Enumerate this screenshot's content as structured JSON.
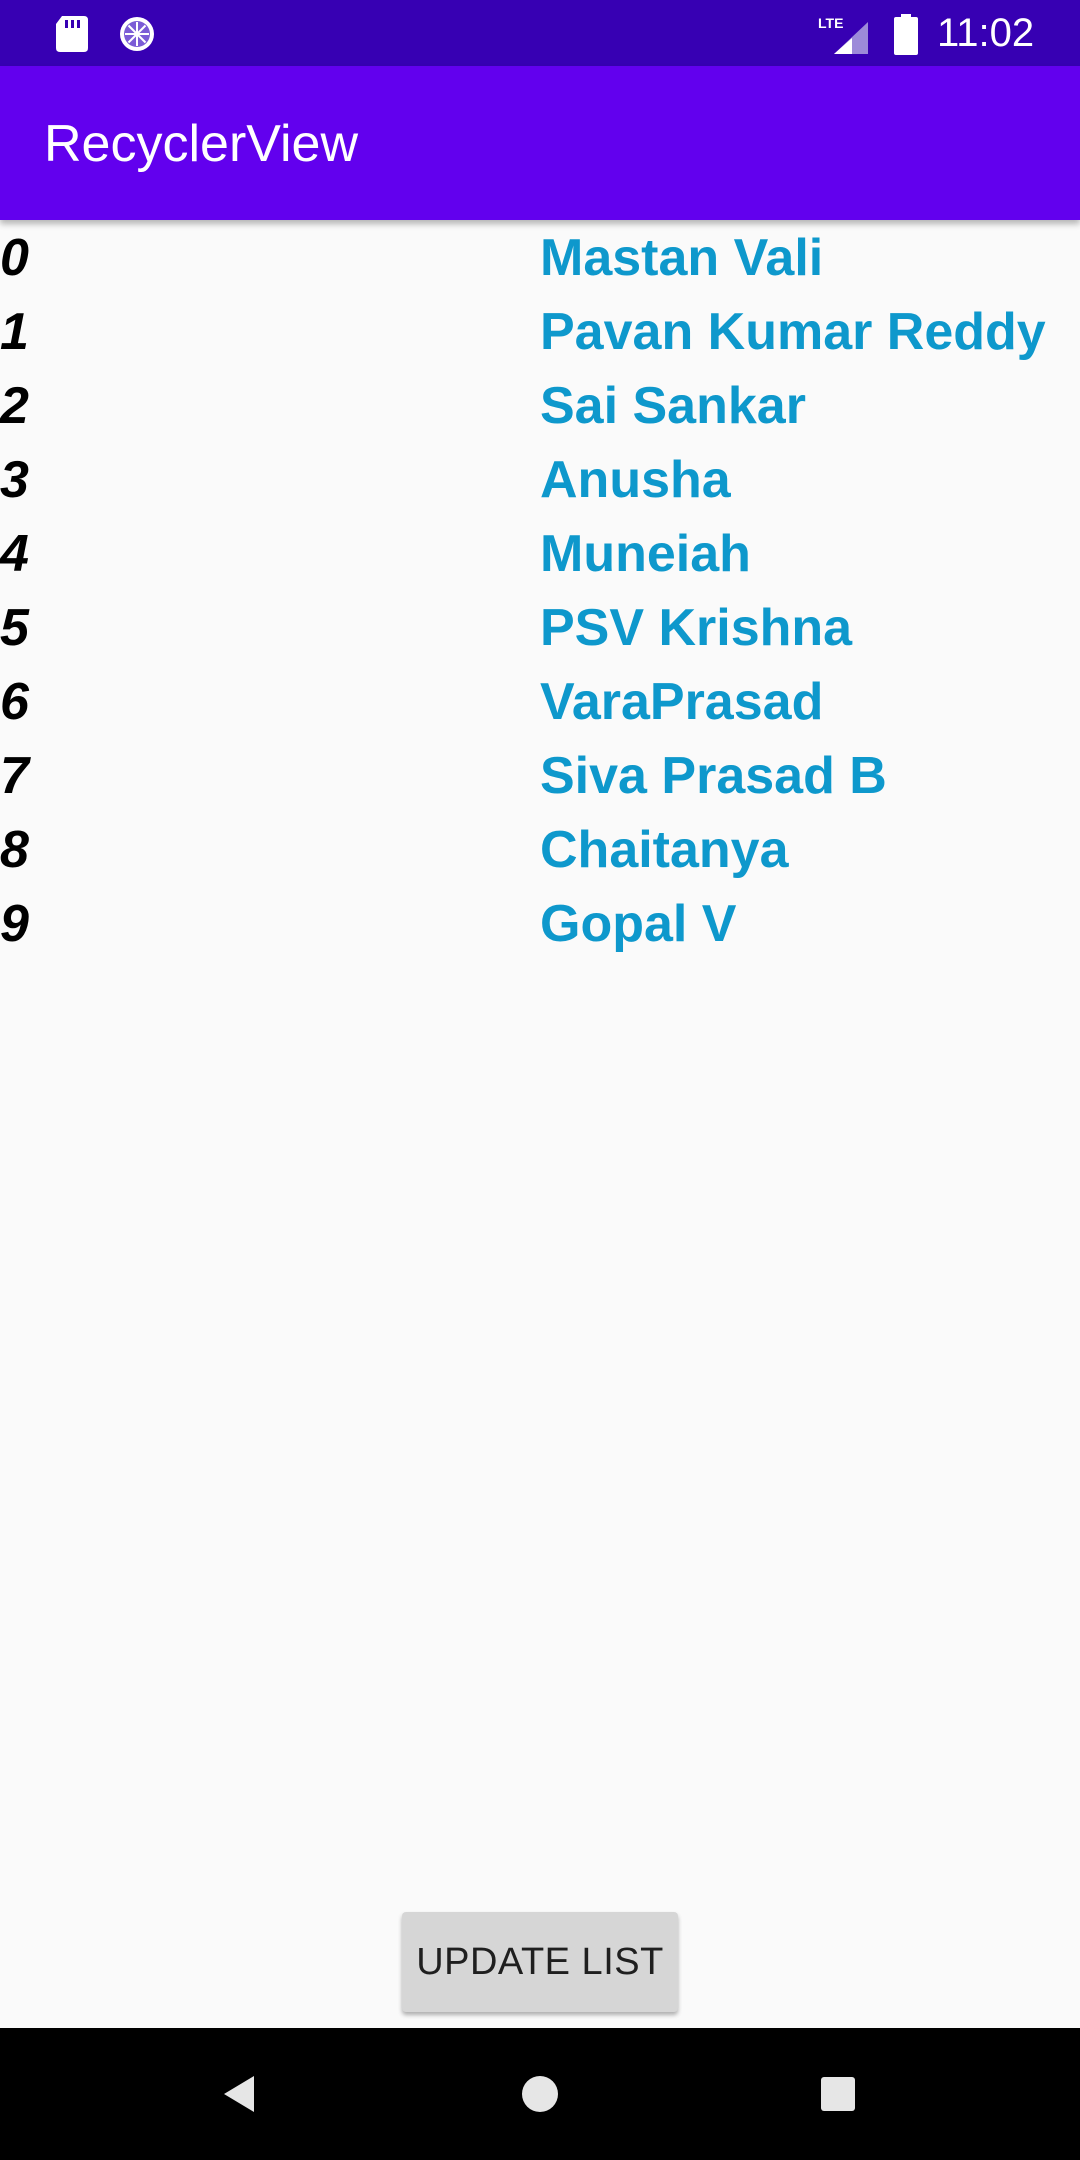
{
  "status_bar": {
    "time": "11:02",
    "network_label": "LTE",
    "icons": [
      "sd-card-icon",
      "sync-icon",
      "lte-signal-icon",
      "battery-icon"
    ]
  },
  "app_bar": {
    "title": "RecyclerView",
    "color": "#6200ee",
    "status_color": "#3700b3"
  },
  "list": {
    "items": [
      {
        "index": "0",
        "name": "Mastan Vali"
      },
      {
        "index": "1",
        "name": "Pavan Kumar Reddy"
      },
      {
        "index": "2",
        "name": "Sai Sankar"
      },
      {
        "index": "3",
        "name": "Anusha"
      },
      {
        "index": "4",
        "name": "Muneiah"
      },
      {
        "index": "5",
        "name": "PSV Krishna"
      },
      {
        "index": "6",
        "name": "VaraPrasad"
      },
      {
        "index": "7",
        "name": "Siva Prasad B"
      },
      {
        "index": "8",
        "name": "Chaitanya"
      },
      {
        "index": "9",
        "name": "Gopal V"
      }
    ],
    "name_color": "#0e98cc"
  },
  "button": {
    "update_label": "UPDATE LIST"
  },
  "nav_bar": {
    "icons": [
      "back-icon",
      "home-icon",
      "recents-icon"
    ]
  }
}
